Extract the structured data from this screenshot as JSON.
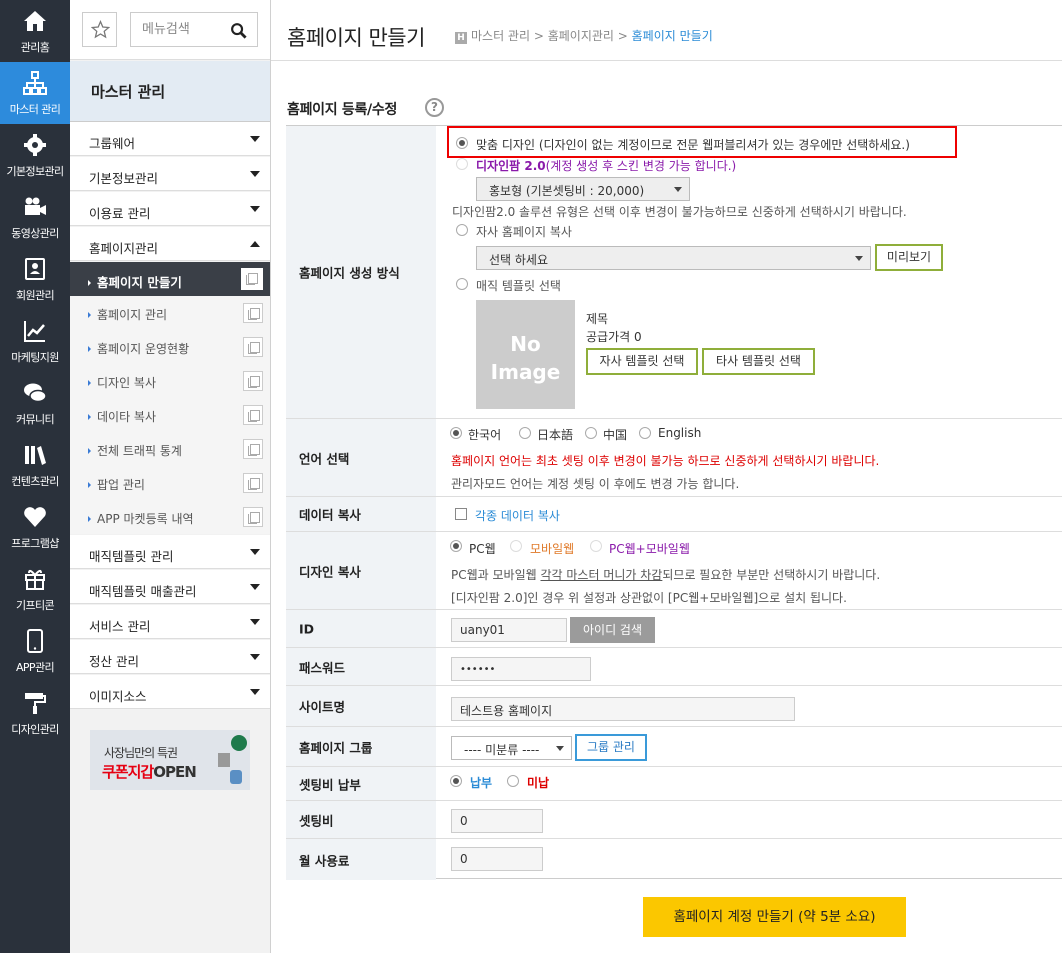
{
  "rail": [
    {
      "label": "관리홈",
      "icon": "home-icon"
    },
    {
      "label": "마스터 관리",
      "icon": "sitemap-icon"
    },
    {
      "label": "기본정보관리",
      "icon": "gear-icon"
    },
    {
      "label": "동영상관리",
      "icon": "video-icon"
    },
    {
      "label": "회원관리",
      "icon": "member-icon"
    },
    {
      "label": "마케팅지원",
      "icon": "chart-icon"
    },
    {
      "label": "커뮤니티",
      "icon": "chat-icon"
    },
    {
      "label": "컨텐츠관리",
      "icon": "books-icon"
    },
    {
      "label": "프로그램샵",
      "icon": "heart-icon"
    },
    {
      "label": "기프티콘",
      "icon": "gift-icon"
    },
    {
      "label": "APP관리",
      "icon": "phone-icon"
    },
    {
      "label": "디자인관리",
      "icon": "roller-icon"
    }
  ],
  "sidebar": {
    "search_placeholder": "메뉴검색",
    "title": "마스터 관리",
    "menus_top": [
      "그룹웨어",
      "기본정보관리",
      "이용료 관리",
      "홈페이지관리"
    ],
    "subs": [
      "홈페이지 만들기",
      "홈페이지 관리",
      "홈페이지 운영현황",
      "디자인 복사",
      "데이타 복사",
      "전체 트래픽 통계",
      "팝업 관리",
      "APP 마켓등록 내역"
    ],
    "menus_bottom": [
      "매직템플릿 관리",
      "매직템플릿 매출관리",
      "서비스 관리",
      "정산 관리",
      "이미지소스"
    ],
    "banner": {
      "line1": "사장님만의 특권",
      "line2_red": "쿠폰지갑",
      "line2": "OPEN"
    }
  },
  "header": {
    "title": "홈페이지 만들기",
    "breadcrumb": [
      "마스터 관리",
      "홈페이지관리",
      "홈페이지 만들기"
    ]
  },
  "section_title": "홈페이지 등록/수정",
  "form": {
    "method": {
      "label": "홈페이지 생성 방식",
      "opt_custom": "맞춤 디자인 (디자인이 없는 계정이므로 전문 웹퍼블리셔가 있는 경우에만 선택하세요.)",
      "opt_designpalm_bold": "디자인팜 2.0",
      "opt_designpalm_rest": "(계정 생성 후 스킨 변경 가능 합니다.)",
      "designpalm_select": "홍보형 (기본셋팅비 : 20,000)",
      "designpalm_note": "디자인팜2.0 솔루션 유형은 선택 이후 변경이 불가능하므로 신중하게 선택하시기 바랍니다.",
      "opt_copy": "자사 홈페이지 복사",
      "copy_select": "선택 하세요",
      "preview_button": "미리보기",
      "opt_magic": "매직 템플릿 선택",
      "no_image_1": "No",
      "no_image_2": "Image",
      "tpl_title": "제목",
      "tpl_price": "공급가격 0",
      "own_tpl_button": "자사 템플릿 선택",
      "other_tpl_button": "타사 템플릿 선택"
    },
    "language": {
      "label": "언어 선택",
      "options": [
        "한국어",
        "日本語",
        "中国",
        "English"
      ],
      "notice": "홈페이지 언어는 최초 셋팅 이후 변경이 불가능 하므로 신중하게 선택하시기 바랍니다.",
      "note": "관리자모드 언어는 계정 셋팅 이 후에도 변경 가능 합니다."
    },
    "data_copy": {
      "label": "데이터 복사",
      "checkbox": "각종 데이터 복사"
    },
    "design_copy": {
      "label": "디자인 복사",
      "options": [
        "PC웹",
        "모바일웹",
        "PC웹+모바일웹"
      ],
      "note_pre": "PC웹과 모바일웹 ",
      "note_link": "각각 마스터 머니가 차감",
      "note_post": "되므로 필요한 부분만 선택하시기 바랍니다.",
      "note2": "[디자인팜 2.0]인 경우 위 설정과 상관없이 [PC웹+모바일웹]으로 설치 됩니다."
    },
    "id": {
      "label": "ID",
      "value": "uany01",
      "button": "아이디 검색"
    },
    "password": {
      "label": "패스워드",
      "value": "••••••"
    },
    "site_name": {
      "label": "사이트명",
      "value": "테스트용 홈페이지"
    },
    "group": {
      "label": "홈페이지 그룹",
      "select": "---- 미분류 ----",
      "button": "그룹 관리"
    },
    "setup_payment": {
      "label": "셋팅비 납부",
      "paid": "납부",
      "unpaid": "미납"
    },
    "setup_fee": {
      "label": "셋팅비",
      "value": "0"
    },
    "monthly_fee": {
      "label": "월 사용료",
      "value": "0"
    }
  },
  "submit_button": "홈페이지 계정 만들기 (약 5분 소요)",
  "colors": {
    "rail_bg": "#2a313b",
    "rail_active": "#2d8bdc",
    "accent_green": "#8fae3a",
    "notice_red": "#dd0000",
    "submit_yellow": "#fbc700"
  }
}
